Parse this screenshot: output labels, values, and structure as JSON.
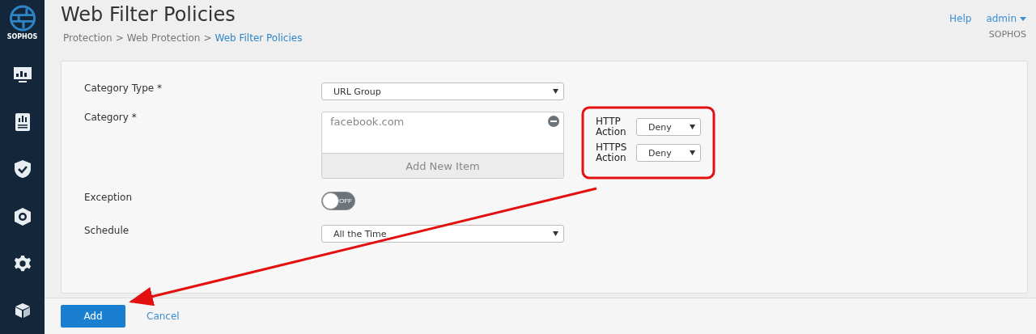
{
  "sidebar": {
    "brand": "SOPHOS",
    "items": [
      {
        "kind": "monitor",
        "selected": false
      },
      {
        "kind": "report",
        "selected": false
      },
      {
        "kind": "shield",
        "selected": false
      },
      {
        "kind": "badge",
        "selected": false
      },
      {
        "kind": "gear",
        "selected": false
      },
      {
        "kind": "cube",
        "selected": false
      }
    ]
  },
  "header": {
    "title": "Web Filter Policies",
    "breadcrumb": [
      {
        "label": "Protection",
        "current": false
      },
      {
        "label": "Web Protection",
        "current": false
      },
      {
        "label": "Web Filter Policies",
        "current": true
      }
    ],
    "separator": ">",
    "help": "Help",
    "user": "admin",
    "org": "SOPHOS"
  },
  "form": {
    "category_type": {
      "label": "Category Type *",
      "value": "URL Group"
    },
    "category": {
      "label": "Category *",
      "items": [
        "facebook.com"
      ],
      "add_item": "Add New Item"
    },
    "actions": [
      {
        "label": "HTTP Action",
        "value": "Deny"
      },
      {
        "label": "HTTPS Action",
        "value": "Deny"
      }
    ],
    "exception": {
      "label": "Exception",
      "on": false,
      "off_text": "OFF"
    },
    "schedule": {
      "label": "Schedule",
      "value": "All the Time"
    }
  },
  "footer": {
    "buttons": [
      {
        "label": "Add",
        "kind": "primary"
      },
      {
        "label": "Cancel",
        "kind": "link"
      }
    ]
  }
}
